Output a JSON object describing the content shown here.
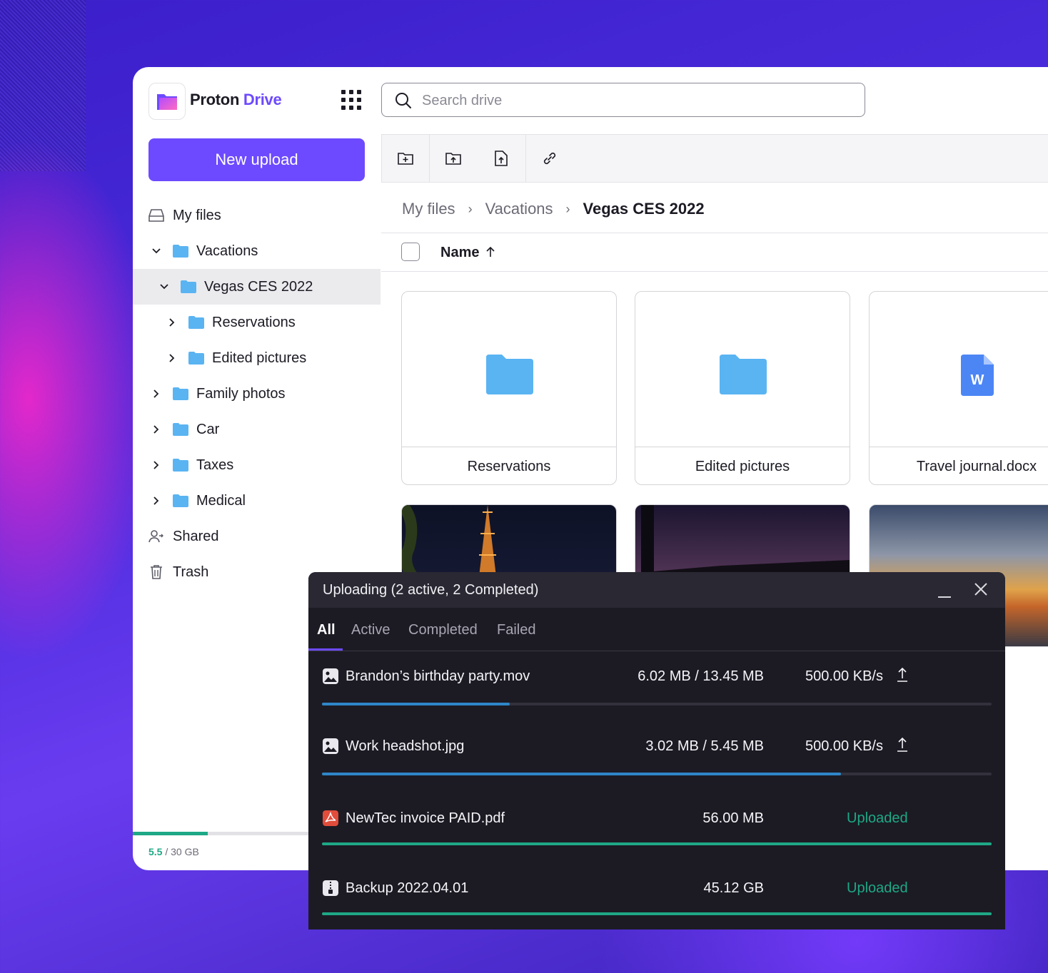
{
  "brand": {
    "name_part1": "Proton",
    "name_part2": "Drive"
  },
  "search": {
    "placeholder": "Search drive"
  },
  "sidebar": {
    "new_upload_label": "New upload",
    "items": [
      {
        "label": "My files",
        "icon": "drive-icon",
        "level": 0
      },
      {
        "label": "Vacations",
        "icon": "folder-icon",
        "level": 0,
        "expanded": true
      },
      {
        "label": "Vegas CES 2022",
        "icon": "folder-icon",
        "level": 1,
        "expanded": true,
        "selected": true
      },
      {
        "label": "Reservations",
        "icon": "folder-icon",
        "level": 2
      },
      {
        "label": "Edited pictures",
        "icon": "folder-icon",
        "level": 2
      },
      {
        "label": "Family photos",
        "icon": "folder-icon",
        "level": 0
      },
      {
        "label": "Car",
        "icon": "folder-icon",
        "level": 0
      },
      {
        "label": "Taxes",
        "icon": "folder-icon",
        "level": 0
      },
      {
        "label": "Medical",
        "icon": "folder-icon",
        "level": 0
      },
      {
        "label": "Shared",
        "icon": "shared-icon",
        "level": 0
      },
      {
        "label": "Trash",
        "icon": "trash-icon",
        "level": 0
      }
    ],
    "storage": {
      "used": "5.5",
      "total": " / 30 GB",
      "used_fraction": 0.183
    }
  },
  "toolbar": {
    "buttons": [
      "new-folder-icon",
      "upload-folder-icon",
      "upload-file-icon",
      "share-link-icon"
    ]
  },
  "breadcrumb": {
    "items": [
      "My files",
      "Vacations"
    ],
    "current": "Vegas CES 2022"
  },
  "list_header": {
    "name_label": "Name"
  },
  "grid": [
    {
      "name": "Reservations",
      "type": "folder"
    },
    {
      "name": "Edited pictures",
      "type": "folder"
    },
    {
      "name": "Travel journal.docx",
      "type": "docx"
    }
  ],
  "upload_panel": {
    "title": "Uploading (2 active, 2 Completed)",
    "tabs": [
      "All",
      "Active",
      "Completed",
      "Failed"
    ],
    "active_tab": "All",
    "rows": [
      {
        "name": "Brandon’s birthday party.mov",
        "icon": "image-icon",
        "size": "6.02 MB / 13.45 MB",
        "speed": "500.00 KB/s",
        "progress": 0.28,
        "status": "uploading"
      },
      {
        "name": "Work headshot.jpg",
        "icon": "image-icon",
        "size": "3.02 MB / 5.45 MB",
        "speed": "500.00 KB/s",
        "progress": 0.775,
        "status": "uploading"
      },
      {
        "name": "NewTec invoice PAID.pdf",
        "icon": "pdf-icon",
        "size": "56.00 MB",
        "status_label": "Uploaded",
        "progress": 1.0,
        "status": "done"
      },
      {
        "name": "Backup 2022.04.01",
        "icon": "zip-icon",
        "size": "45.12 GB",
        "status_label": "Uploaded",
        "progress": 1.0,
        "status": "done"
      }
    ]
  },
  "colors": {
    "accent": "#6d4aff",
    "success": "#1ea885",
    "progress_active": "#2f86c8",
    "folder": "#5ab4f2"
  }
}
